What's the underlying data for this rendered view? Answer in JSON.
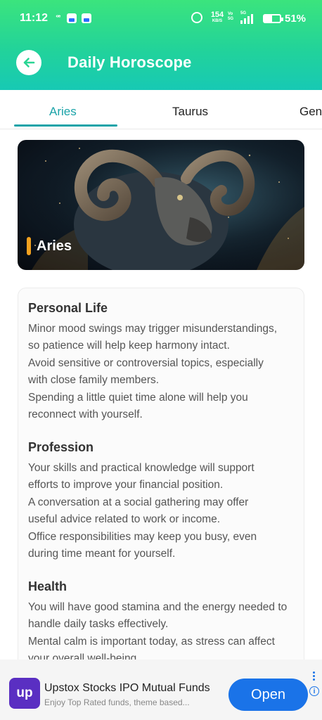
{
  "status_bar": {
    "time": "11:12",
    "net_speed_value": "154",
    "net_speed_unit": "KB/S",
    "battery_percent": "51%",
    "battery_level": 0.51
  },
  "app_bar": {
    "title": "Daily Horoscope",
    "back_icon": "arrow-left-icon",
    "gradient_colors": [
      "#3be47d",
      "#17c9b4"
    ]
  },
  "tabs": [
    {
      "label": "Aries",
      "active": true
    },
    {
      "label": "Taurus",
      "active": false
    },
    {
      "label": "Gen",
      "active": false
    }
  ],
  "accent_color": "#1aa3a8",
  "hero": {
    "name": "Aries",
    "image": "ram-illustration",
    "marker_color": "#f2a11f"
  },
  "sections": [
    {
      "title": "Personal Life",
      "lines": [
        "Minor mood swings may trigger misunderstandings,",
        "so patience will help keep harmony intact.",
        " Avoid sensitive or controversial topics, especially",
        "with close family members.",
        " Spending a little quiet time alone will help you",
        "reconnect with yourself."
      ]
    },
    {
      "title": "Profession",
      "lines": [
        "Your skills and practical knowledge will support",
        "efforts to improve your financial position.",
        " A conversation at a social gathering may offer",
        "useful advice related to work or income.",
        " Office responsibilities may keep you busy, even",
        "during time meant for yourself."
      ]
    },
    {
      "title": "Health",
      "lines": [
        "You will have good stamina and the energy needed to",
        "handle daily tasks effectively.",
        " Mental calm is important today, as stress can affect",
        "your overall well-being."
      ]
    }
  ],
  "ad": {
    "logo_text": "up",
    "title": "Upstox Stocks IPO Mutual Funds",
    "subtitle": "Enjoy Top Rated funds, theme based...",
    "cta": "Open",
    "info_icon": "info-icon",
    "cta_color": "#1a73e8"
  }
}
